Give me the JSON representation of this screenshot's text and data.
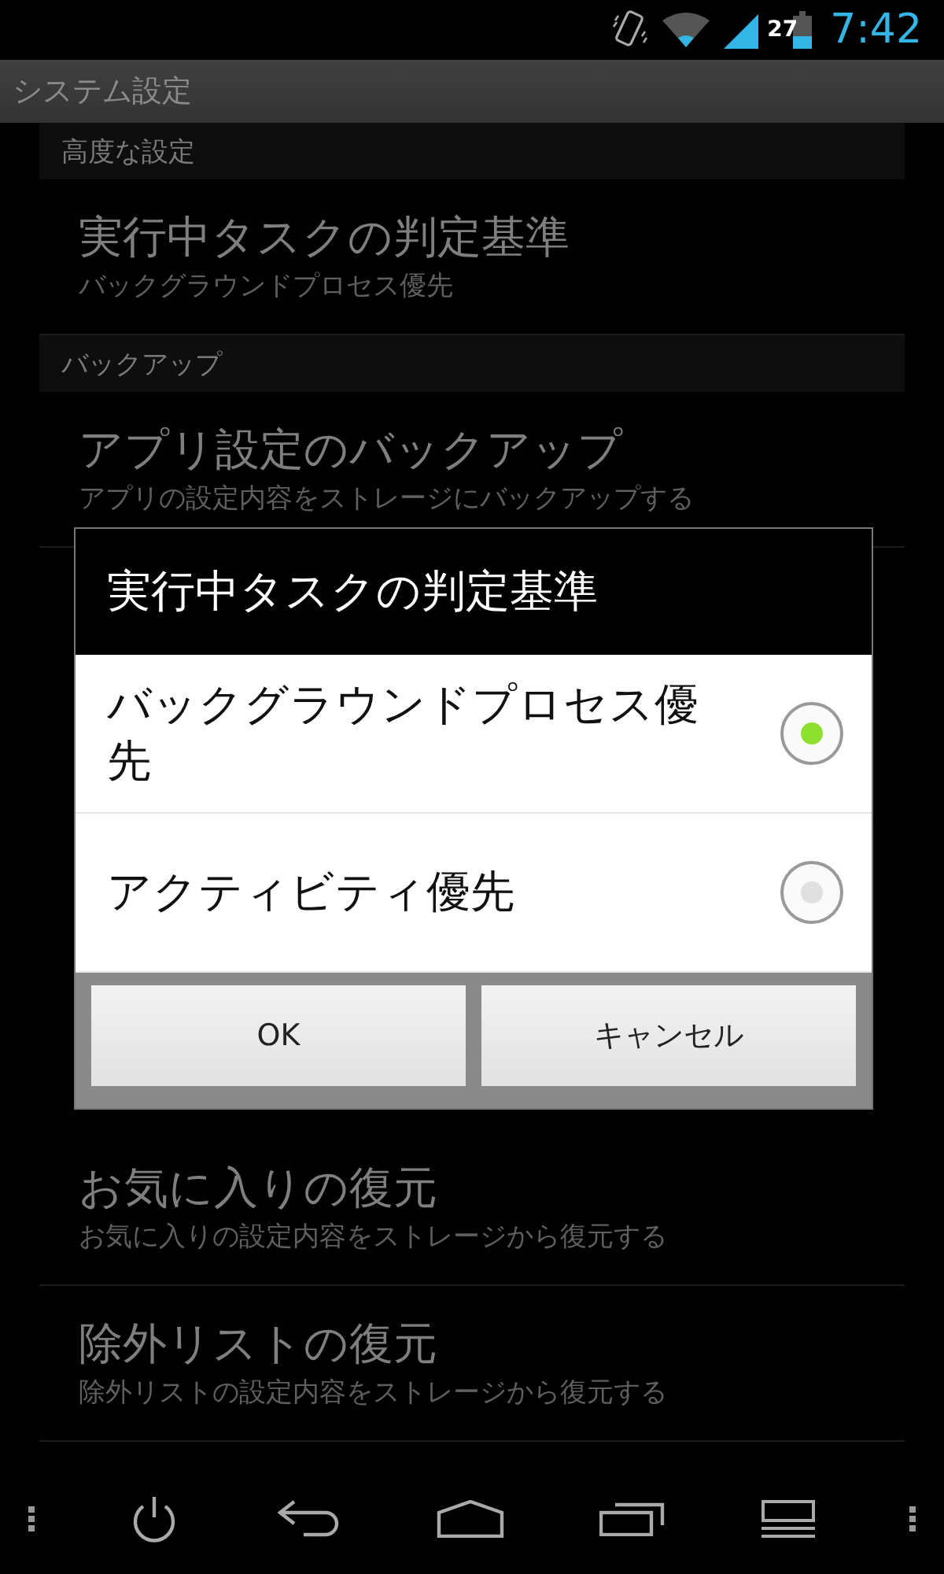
{
  "status_bar": {
    "battery": "27",
    "time": "7:42"
  },
  "app_bar": {
    "title": "システム設定"
  },
  "sections": [
    {
      "kind": "header",
      "title": "高度な設定"
    },
    {
      "kind": "item",
      "title": "実行中タスクの判定基準",
      "summary": "バックグラウンドプロセス優先"
    },
    {
      "kind": "header",
      "title": "バックアップ"
    },
    {
      "kind": "item",
      "title": "アプリ設定のバックアップ",
      "summary": "アプリの設定内容をストレージにバックアップする"
    },
    {
      "kind": "hidden"
    },
    {
      "kind": "item",
      "title": "お気に入りの復元",
      "summary": "お気に入りの設定内容をストレージから復元する"
    },
    {
      "kind": "item",
      "title": "除外リストの復元",
      "summary": "除外リストの設定内容をストレージから復元する"
    }
  ],
  "dialog": {
    "title": "実行中タスクの判定基準",
    "options": [
      {
        "label": "バックグラウンドプロセス優先",
        "selected": true
      },
      {
        "label": "アクティビティ優先",
        "selected": false
      }
    ],
    "buttons": [
      "OK",
      "キャンセル"
    ]
  }
}
